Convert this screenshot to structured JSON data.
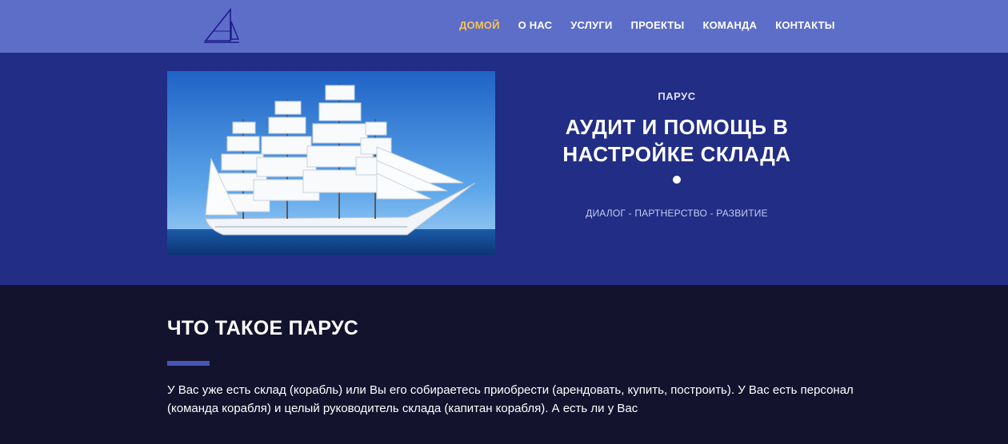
{
  "header": {
    "logo_icon": "sailboat-icon",
    "nav": [
      {
        "label": "ДОМОЙ",
        "active": true
      },
      {
        "label": "О НАС",
        "active": false
      },
      {
        "label": "УСЛУГИ",
        "active": false
      },
      {
        "label": "ПРОЕКТЫ",
        "active": false
      },
      {
        "label": "КОМАНДА",
        "active": false
      },
      {
        "label": "КОНТАКТЫ",
        "active": false
      }
    ],
    "active_color": "#f7c35a",
    "background": "#5d6ec9"
  },
  "hero": {
    "image": "sailing-ship-image",
    "eyebrow": "ПАРУС",
    "title_line1": "АУДИТ И ПОМОЩЬ В",
    "title_line2": "НАСТРОЙКЕ СКЛАДА",
    "tagline": "ДИАЛОГ - ПАРТНЕРСТВО - РАЗВИТИЕ",
    "background": "#222d86"
  },
  "about": {
    "heading": "ЧТО ТАКОЕ ПАРУС",
    "text": "У Вас уже есть склад (корабль) или Вы его собираетесь приобрести (арендовать, купить, построить). У Вас есть персонал (команда корабля) и целый руководитель склада (капитан корабля). А есть ли у Вас",
    "accent": "#4656b8",
    "background": "#14132e"
  }
}
